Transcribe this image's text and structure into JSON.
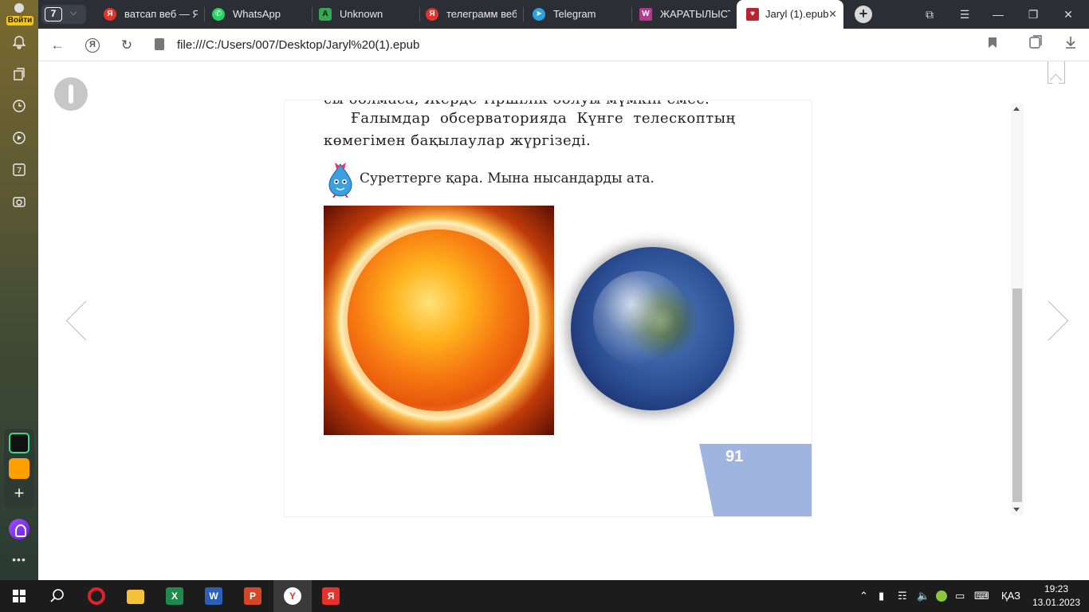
{
  "sidebar": {
    "login_label": "Войти",
    "icons": [
      "bell-icon",
      "collections-icon",
      "history-icon",
      "play-icon",
      "seven-icon",
      "screenshot-icon"
    ],
    "seven_label": "7",
    "more_label": "•••"
  },
  "tabs": {
    "count": "7",
    "items": [
      {
        "label": "ватсап веб — Я",
        "favicon": "yandex-icon",
        "color": "#e5322d"
      },
      {
        "label": "WhatsApp",
        "favicon": "whatsapp-icon",
        "color": "#25d366"
      },
      {
        "label": "Unknown",
        "favicon": "unknown-app-icon",
        "color": "#34a853"
      },
      {
        "label": "телеграмм веб",
        "favicon": "yandex-icon",
        "color": "#e5322d"
      },
      {
        "label": "Telegram",
        "favicon": "telegram-icon",
        "color": "#2aa3df"
      },
      {
        "label": "ЖАРАТЫЛЫСТА",
        "favicon": "book-icon",
        "color": "#b23b8d"
      },
      {
        "label": "Jaryl (1).epub",
        "favicon": "epub-icon",
        "color": "#b8232f",
        "active": true
      }
    ],
    "close_glyph": "✕",
    "new_tab_glyph": "+"
  },
  "window_controls": [
    "tabs-sync-icon",
    "menu-icon",
    "minimize-icon",
    "restore-icon",
    "close-icon"
  ],
  "address_bar": {
    "url": "file:///C:/Users/007/Desktop/Jaryl%20(1).epub",
    "yandex_glyph": "Я"
  },
  "book": {
    "cut_line": "сы болмаса, Жерде тіршілік болуы мүмкін емес.",
    "line1": "Ғалымдар обсерваторияда Күнге телескоптың",
    "line2": "көмегімен бақылаулар жүргізеді.",
    "task": "Суреттерге қара. Мына нысандарды ата.",
    "page_number": "91",
    "images": [
      "sun-image",
      "earth-image"
    ]
  },
  "taskbar": {
    "apps": [
      "windows-start-icon",
      "search-icon",
      "opera-icon",
      "file-explorer-icon",
      "excel-icon",
      "word-icon",
      "powerpoint-icon",
      "yandex-browser-icon",
      "yandex-icon"
    ],
    "language": "ҚАЗ",
    "time": "19:23",
    "date": "13.01.2023"
  }
}
